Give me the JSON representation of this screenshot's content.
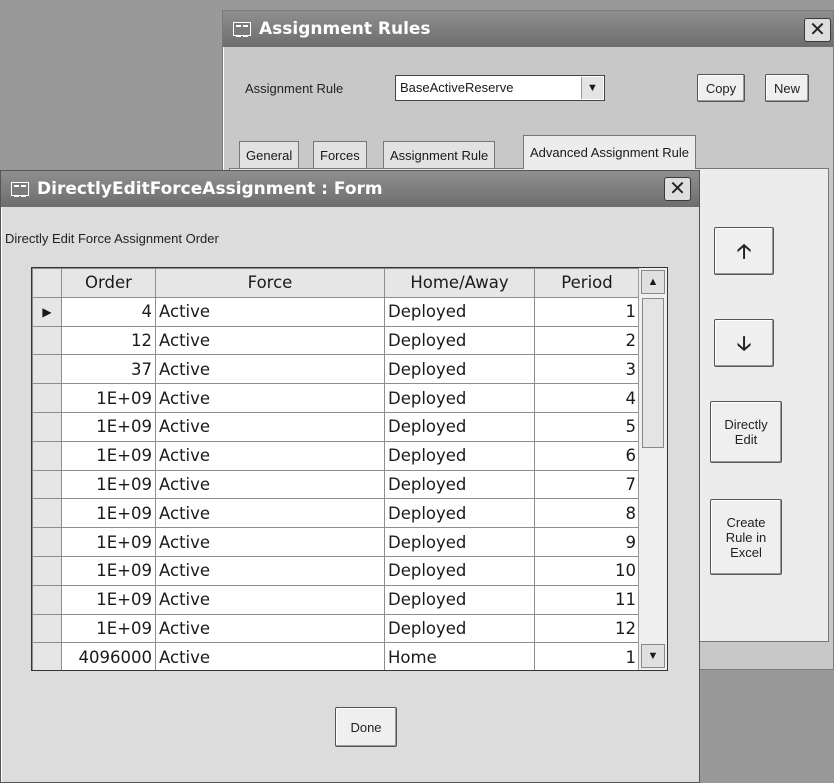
{
  "back_window": {
    "title": "Assignment Rules",
    "close_glyph": "✕",
    "rule_label": "Assignment Rule",
    "rule_value": "BaseActiveReserve",
    "copy_label": "Copy",
    "new_label": "New",
    "tabs": [
      "General",
      "Forces",
      "Assignment Rule",
      "Advanced Assignment Rule"
    ],
    "active_tab": "Advanced Assignment Rule",
    "move_up_glyph": "🡡",
    "move_down_glyph": "🡣",
    "directly_edit_label": "Directly Edit",
    "create_rule_label": "Create Rule in Excel"
  },
  "form": {
    "title": "DirectlyEditForceAssignment : Form",
    "close_glyph": "✕",
    "heading": "Directly Edit Force Assignment Order",
    "done_label": "Done",
    "columns": [
      "Order",
      "Force",
      "Home/Away",
      "Period"
    ],
    "row_selector_glyph": "▶",
    "rows": [
      [
        "4",
        "Active",
        "Deployed",
        "1"
      ],
      [
        "12",
        "Active",
        "Deployed",
        "2"
      ],
      [
        "37",
        "Active",
        "Deployed",
        "3"
      ],
      [
        "1E+09",
        "Active",
        "Deployed",
        "4"
      ],
      [
        "1E+09",
        "Active",
        "Deployed",
        "5"
      ],
      [
        "1E+09",
        "Active",
        "Deployed",
        "6"
      ],
      [
        "1E+09",
        "Active",
        "Deployed",
        "7"
      ],
      [
        "1E+09",
        "Active",
        "Deployed",
        "8"
      ],
      [
        "1E+09",
        "Active",
        "Deployed",
        "9"
      ],
      [
        "1E+09",
        "Active",
        "Deployed",
        "10"
      ],
      [
        "1E+09",
        "Active",
        "Deployed",
        "11"
      ],
      [
        "1E+09",
        "Active",
        "Deployed",
        "12"
      ],
      [
        "4096000",
        "Active",
        "Home",
        "1"
      ]
    ],
    "current_row": 0
  },
  "icons": {
    "form_icon": "form-icon",
    "scroll_up": "scroll-up-icon",
    "scroll_down": "scroll-down-icon"
  }
}
